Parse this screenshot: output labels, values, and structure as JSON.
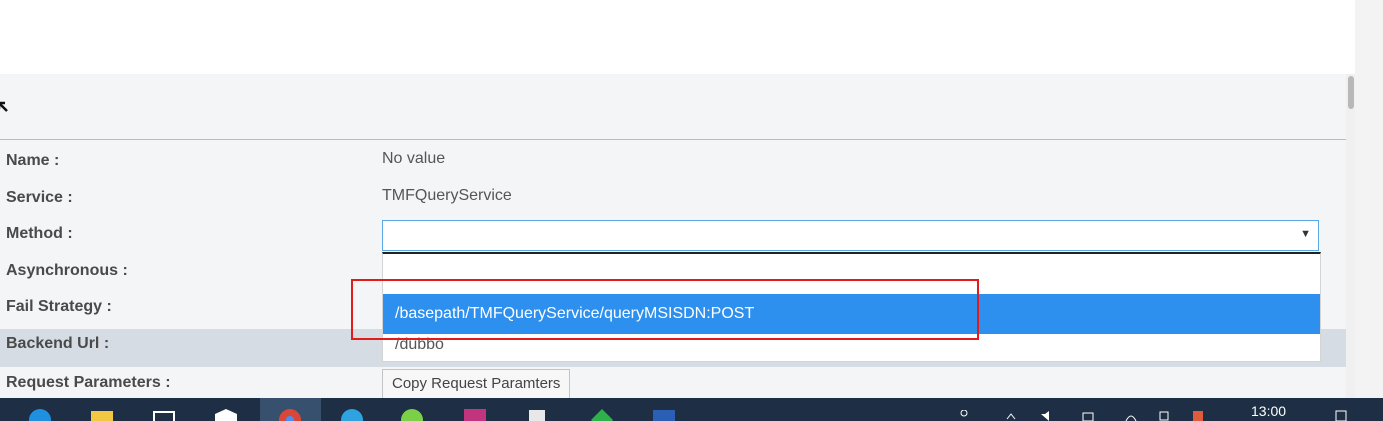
{
  "form": {
    "labels": {
      "name": "Name :",
      "service": "Service :",
      "method": "Method :",
      "asynchronous": "Asynchronous :",
      "fail_strategy": "Fail Strategy :",
      "backend_url": "Backend Url :",
      "request_parameters": "Request Parameters :"
    },
    "values": {
      "name": "No value",
      "service": "TMFQueryService"
    },
    "method_select": {
      "selected": "",
      "options": [
        "",
        "/basepath/TMFQueryService/queryMSISDN:POST",
        "/dubbo"
      ],
      "highlighted_index": 1
    },
    "copy_button_label": "Copy Request Paramters"
  },
  "taskbar": {
    "clock": "13:00",
    "apps": [
      "edge-icon",
      "file-explorer-icon",
      "store-icon",
      "mail-icon",
      "chrome-icon",
      "telegram-icon",
      "wechat-icon",
      "intellij-icon",
      "notepad-icon",
      "git-icon",
      "word-icon"
    ]
  },
  "colors": {
    "highlight": "#2d8fee",
    "annotation": "#e21b1b",
    "taskbar": "#1e2f45",
    "select_border": "#5aa9e6"
  }
}
